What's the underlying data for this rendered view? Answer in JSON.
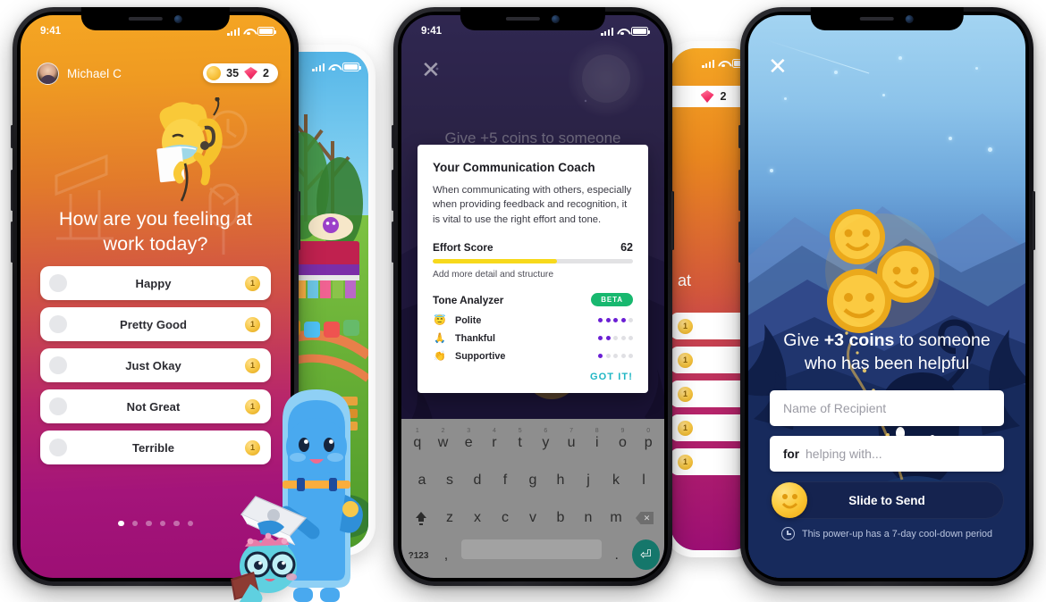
{
  "colors": {
    "mood_gradient_start": "#f5a623",
    "mood_gradient_end": "#9c0f74",
    "coach_accent_yellow": "#f7d91c",
    "beta_green": "#18b86f",
    "got_it_teal": "#1fb6c4",
    "tone_dot_purple": "#6b1fd4",
    "deep_blue": "#102050",
    "slide_track": "#15234f"
  },
  "phone1": {
    "statusbar": {
      "time": "9:41",
      "signal_icon": "cellular-bars-icon",
      "wifi_icon": "wifi-icon",
      "battery_icon": "battery-icon"
    },
    "user_name": "Michael C",
    "avatar_icon": "user-avatar",
    "currency": {
      "coin_icon": "coin-icon",
      "coin_count": "35",
      "gem_icon": "gem-icon",
      "gem_count": "2"
    },
    "mascot_icon": "yellow-mascot-with-headset",
    "question": "How are you feeling at work today?",
    "mood_options": [
      {
        "label": "Happy",
        "reward": "1"
      },
      {
        "label": "Pretty Good",
        "reward": "1"
      },
      {
        "label": "Just Okay",
        "reward": "1"
      },
      {
        "label": "Not Great",
        "reward": "1"
      },
      {
        "label": "Terrible",
        "reward": "1"
      }
    ],
    "pagination": {
      "total": 6,
      "active_index": 0
    }
  },
  "phone1b": {
    "screen_icon": "isometric-game-map"
  },
  "phone2": {
    "statusbar": {
      "time": "9:41"
    },
    "close_icon": "close-icon",
    "background_prompt": "Give +5 coins to someone",
    "dialog": {
      "title": "Your Communication Coach",
      "body": "When communicating with others, especially when providing feedback and recognition, it is vital to use the right effort and tone.",
      "effort_label": "Effort Score",
      "effort_value": "62",
      "effort_percent": 62,
      "effort_tip": "Add more detail and structure",
      "tone_label": "Tone Analyzer",
      "beta_badge": "BETA",
      "tones": [
        {
          "emoji": "😇",
          "icon": "angel-face-emoji",
          "name": "Polite",
          "filled": 4,
          "total": 5
        },
        {
          "emoji": "🙏",
          "icon": "praying-hands-emoji",
          "name": "Thankful",
          "filled": 2,
          "total": 5
        },
        {
          "emoji": "👏",
          "icon": "clapping-hands-emoji",
          "name": "Supportive",
          "filled": 1,
          "total": 5
        }
      ],
      "cta": "GOT IT!"
    },
    "keyboard": {
      "row1": [
        {
          "key": "q",
          "num": "1"
        },
        {
          "key": "w",
          "num": "2"
        },
        {
          "key": "e",
          "num": "3"
        },
        {
          "key": "r",
          "num": "4"
        },
        {
          "key": "t",
          "num": "5"
        },
        {
          "key": "y",
          "num": "6"
        },
        {
          "key": "u",
          "num": "7"
        },
        {
          "key": "i",
          "num": "8"
        },
        {
          "key": "o",
          "num": "9"
        },
        {
          "key": "p",
          "num": "0"
        }
      ],
      "row2": [
        "a",
        "s",
        "d",
        "f",
        "g",
        "h",
        "j",
        "k",
        "l"
      ],
      "row3": [
        "z",
        "x",
        "c",
        "v",
        "b",
        "n",
        "m"
      ],
      "shift_icon": "shift-key-icon",
      "backspace_icon": "backspace-key-icon",
      "symbols_key": "?123",
      "comma_key": ",",
      "period_key": ".",
      "space_key": "",
      "enter_icon": "enter-key-icon"
    }
  },
  "phone2b": {
    "gem_icon": "gem-icon",
    "gem_count": "2",
    "partial_title": "at",
    "row_reward": "1",
    "row_count": 5
  },
  "phone3": {
    "close_icon": "close-icon",
    "scene_icon": "night-mountains-with-coins",
    "title_prefix": "Give ",
    "title_bold": "+3 coins",
    "title_suffix": " to someone who has been helpful",
    "recipient_placeholder": "Name of Recipient",
    "reason_prefix": "for",
    "reason_placeholder": "helping with...",
    "slide_label": "Slide to Send",
    "slide_coin_icon": "smiley-coin-icon",
    "cooldown_icon": "clock-history-icon",
    "cooldown_text": "This power-up has a 7-day cool-down period"
  },
  "mascots": {
    "tall_icon": "blue-mascot-with-laptop",
    "small_icon": "small-blue-mascot-with-glasses"
  }
}
